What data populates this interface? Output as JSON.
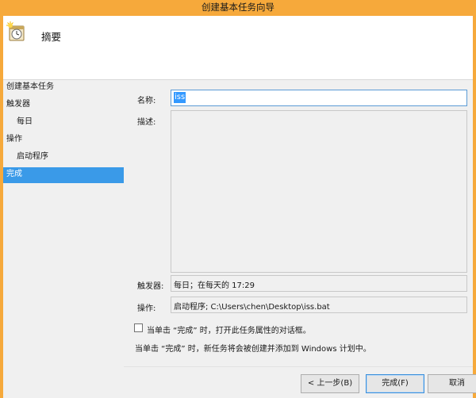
{
  "window": {
    "title": "创建基本任务向导"
  },
  "header": {
    "icon": "task-scheduler-clock-icon",
    "title": "摘要"
  },
  "nav": {
    "items": [
      {
        "label": "创建基本任务"
      },
      {
        "label": "触发器"
      },
      {
        "label": "每日"
      },
      {
        "label": "操作"
      },
      {
        "label": "启动程序"
      },
      {
        "label": "完成"
      }
    ]
  },
  "form": {
    "name_label": "名称:",
    "name_value": "iss",
    "desc_label": "描述:",
    "desc_value": "",
    "trigger_label": "触发器:",
    "trigger_value": "每日；在每天的 17:29",
    "action_label": "操作:",
    "action_value": "启动程序; C:\\Users\\chen\\Desktop\\iss.bat",
    "checkbox_label": "当单击 “完成” 时，打开此任务属性的对话框。",
    "checkbox_checked": false,
    "info_text": "当单击 “完成” 时，新任务将会被创建并添加到 Windows 计划中。"
  },
  "buttons": {
    "back": "< 上一步(B)",
    "finish": "完成(F)",
    "cancel": "取消"
  },
  "colors": {
    "titlebar": "#f6a93b",
    "selected": "#3a9ae8",
    "input_border": "#5b9bd5"
  }
}
